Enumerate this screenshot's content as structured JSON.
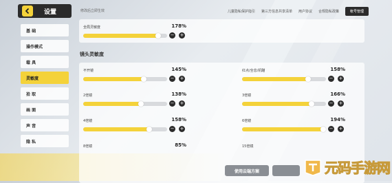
{
  "sidebar": {
    "title": "设置",
    "items": [
      {
        "label": "基 础",
        "active": false
      },
      {
        "label": "操作模式",
        "active": false
      },
      {
        "label": "载 具",
        "active": false
      },
      {
        "label": "灵敏度",
        "active": true
      },
      {
        "label": "拾 取",
        "active": false
      },
      {
        "label": "画 面",
        "active": false
      },
      {
        "label": "声 音",
        "active": false
      },
      {
        "label": "隐 私",
        "active": false
      }
    ]
  },
  "header": {
    "hint": "修改后立即生效",
    "links": [
      "儿童隐私保护指引",
      "第三方信息共享清单",
      "用户协议",
      "合规隐私政策"
    ],
    "account_button": "帐号管理"
  },
  "global": {
    "label": "全局灵敏度",
    "value": "178%",
    "fraction": 0.89
  },
  "lens_section": {
    "title": "镜头灵敏度",
    "items": [
      {
        "label": "不开镜",
        "value": "145%",
        "fraction": 0.72
      },
      {
        "label": "红点/全息/机瞄",
        "value": "158%",
        "fraction": 0.79
      },
      {
        "label": "2倍镜",
        "value": "138%",
        "fraction": 0.69
      },
      {
        "label": "3倍镜",
        "value": "166%",
        "fraction": 0.83
      },
      {
        "label": "4倍镜",
        "value": "158%",
        "fraction": 0.79
      },
      {
        "label": "6倍镜",
        "value": "194%",
        "fraction": 0.97
      },
      {
        "label": "8倍镜",
        "value": "85%",
        "fraction": 0.42
      },
      {
        "label": "15倍镜",
        "value": "",
        "fraction": 0.0
      }
    ]
  },
  "bottom": {
    "cloud_button": "使用云端方案"
  },
  "watermark": {
    "text": "元码手游网"
  },
  "colors": {
    "accent": "#f4d23a",
    "dark": "#2b2b2b"
  }
}
